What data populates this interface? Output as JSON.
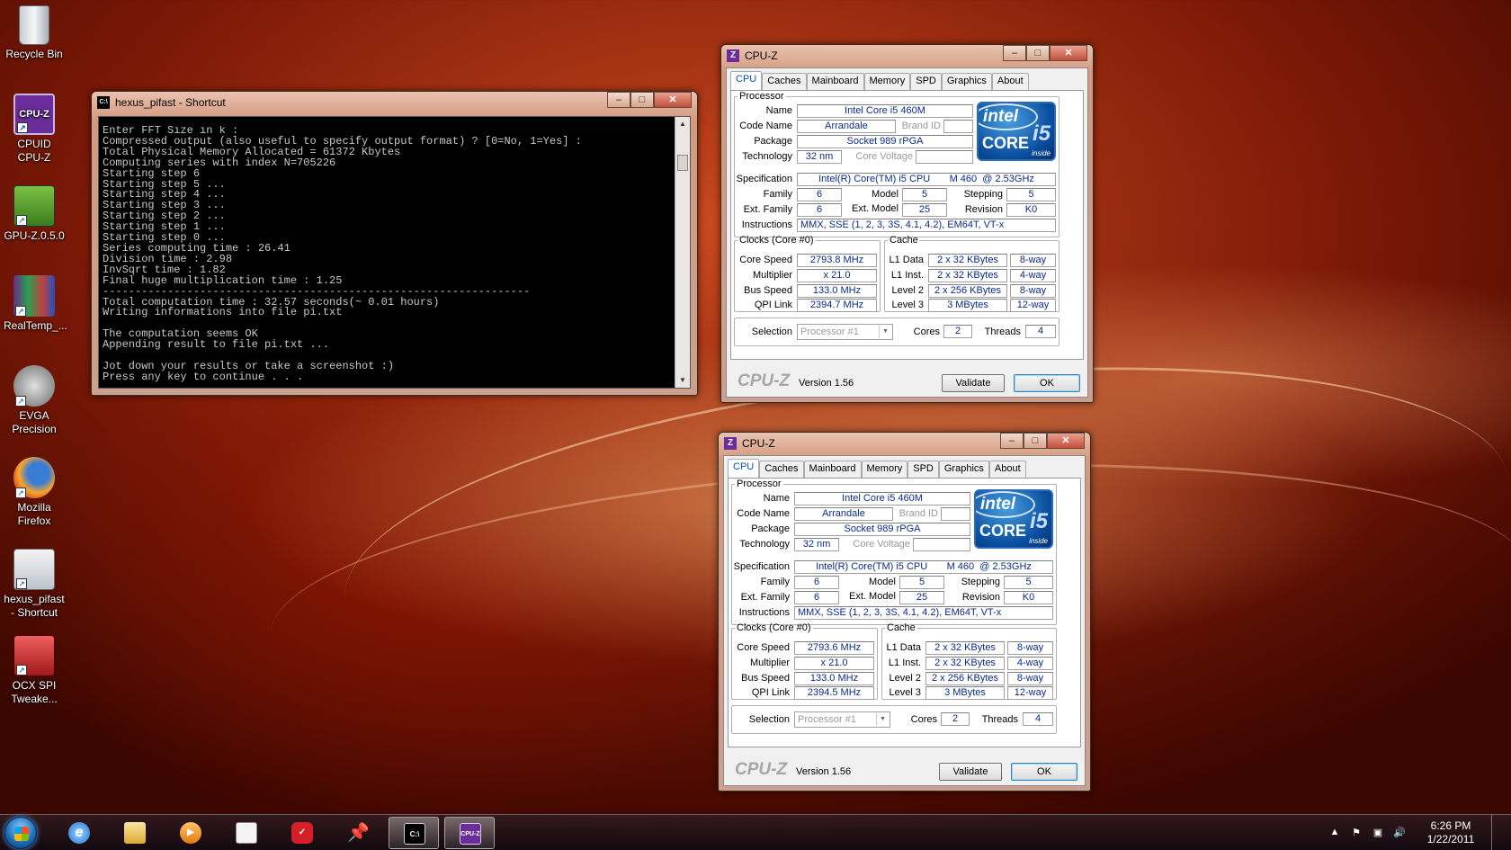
{
  "desktop": {
    "icons": [
      {
        "label": "Recycle Bin",
        "icon": "recycle-bin-icon"
      },
      {
        "label": "CPUID CPU-Z",
        "icon": "cpu-z-icon"
      },
      {
        "label": "GPU-Z.0.5.0",
        "icon": "gpu-z-icon"
      },
      {
        "label": "RealTemp_...",
        "icon": "realtemp-icon"
      },
      {
        "label": "EVGA Precision",
        "icon": "evga-precision-icon"
      },
      {
        "label": "Mozilla Firefox",
        "icon": "firefox-icon"
      },
      {
        "label": "hexus_pifast - Shortcut",
        "icon": "pifast-icon"
      },
      {
        "label": "OCX SPI Tweake...",
        "icon": "ocx-spi-icon"
      }
    ]
  },
  "console": {
    "title": "hexus_pifast - Shortcut",
    "icon_text": "C:\\",
    "output": "Enter FFT Size in k :\nCompressed output (also useful to specify output format) ? [0=No, 1=Yes] :\nTotal Physical Memory Allocated = 61372 Kbytes\nComputing series with index N=705226\nStarting step 6\nStarting step 5 ...\nStarting step 4 ...\nStarting step 3 ...\nStarting step 2 ...\nStarting step 1 ...\nStarting step 0 ...\nSeries computing time : 26.41\nDivision time : 2.98\nInvSqrt time : 1.82\nFinal huge multiplication time : 1.25\n------------------------------------------------------------------\nTotal computation time : 32.57 seconds(~ 0.01 hours)\nWriting informations into file pi.txt\n\nThe computation seems OK\nAppending result to file pi.txt ...\n\nJot down your results or take a screenshot :)\nPress any key to continue . . ."
  },
  "cpuz_windows": [
    {
      "title": "CPU-Z",
      "tabs": [
        "CPU",
        "Caches",
        "Mainboard",
        "Memory",
        "SPD",
        "Graphics",
        "About"
      ],
      "processor": {
        "group": "Processor",
        "name_label": "Name",
        "name": "Intel Core i5 460M",
        "codename_label": "Code Name",
        "codename": "Arrandale",
        "brandid_label": "Brand ID",
        "package_label": "Package",
        "package": "Socket 989 rPGA",
        "technology_label": "Technology",
        "technology": "32 nm",
        "voltage_label": "Core Voltage",
        "spec_label": "Specification",
        "spec": "Intel(R) Core(TM) i5 CPU       M 460  @ 2.53GHz",
        "family_label": "Family",
        "family": "6",
        "model_label": "Model",
        "model": "5",
        "stepping_label": "Stepping",
        "stepping": "5",
        "extfamily_label": "Ext. Family",
        "extfamily": "6",
        "extmodel_label": "Ext. Model",
        "extmodel": "25",
        "revision_label": "Revision",
        "revision": "K0",
        "instructions_label": "Instructions",
        "instructions": "MMX, SSE (1, 2, 3, 3S, 4.1, 4.2), EM64T, VT-x"
      },
      "logo": {
        "intel": "intel",
        "core": "CORE",
        "i5": "i5",
        "inside": "inside"
      },
      "clocks": {
        "group": "Clocks (Core #0)",
        "corespeed_label": "Core Speed",
        "corespeed": "2793.8 MHz",
        "multiplier_label": "Multiplier",
        "multiplier": "x 21.0",
        "busspeed_label": "Bus Speed",
        "busspeed": "133.0 MHz",
        "qpi_label": "QPI Link",
        "qpi": "2394.7 MHz"
      },
      "cache": {
        "group": "Cache",
        "l1d_label": "L1 Data",
        "l1d": "2 x 32 KBytes",
        "l1d_way": "8-way",
        "l1i_label": "L1 Inst.",
        "l1i": "2 x 32 KBytes",
        "l1i_way": "4-way",
        "l2_label": "Level 2",
        "l2": "2 x 256 KBytes",
        "l2_way": "8-way",
        "l3_label": "Level 3",
        "l3": "3 MBytes",
        "l3_way": "12-way"
      },
      "selection": {
        "label": "Selection",
        "value": "Processor #1",
        "cores_label": "Cores",
        "cores": "2",
        "threads_label": "Threads",
        "threads": "4"
      },
      "footer": {
        "brand": "CPU-Z",
        "version": "Version 1.56",
        "validate": "Validate",
        "ok": "OK"
      }
    },
    {
      "title": "CPU-Z",
      "tabs": [
        "CPU",
        "Caches",
        "Mainboard",
        "Memory",
        "SPD",
        "Graphics",
        "About"
      ],
      "processor": {
        "group": "Processor",
        "name_label": "Name",
        "name": "Intel Core i5 460M",
        "codename_label": "Code Name",
        "codename": "Arrandale",
        "brandid_label": "Brand ID",
        "package_label": "Package",
        "package": "Socket 989 rPGA",
        "technology_label": "Technology",
        "technology": "32 nm",
        "voltage_label": "Core Voltage",
        "spec_label": "Specification",
        "spec": "Intel(R) Core(TM) i5 CPU       M 460  @ 2.53GHz",
        "family_label": "Family",
        "family": "6",
        "model_label": "Model",
        "model": "5",
        "stepping_label": "Stepping",
        "stepping": "5",
        "extfamily_label": "Ext. Family",
        "extfamily": "6",
        "extmodel_label": "Ext. Model",
        "extmodel": "25",
        "revision_label": "Revision",
        "revision": "K0",
        "instructions_label": "Instructions",
        "instructions": "MMX, SSE (1, 2, 3, 3S, 4.1, 4.2), EM64T, VT-x"
      },
      "logo": {
        "intel": "intel",
        "core": "CORE",
        "i5": "i5",
        "inside": "inside"
      },
      "clocks": {
        "group": "Clocks (Core #0)",
        "corespeed_label": "Core Speed",
        "corespeed": "2793.6 MHz",
        "multiplier_label": "Multiplier",
        "multiplier": "x 21.0",
        "busspeed_label": "Bus Speed",
        "busspeed": "133.0 MHz",
        "qpi_label": "QPI Link",
        "qpi": "2394.5 MHz"
      },
      "cache": {
        "group": "Cache",
        "l1d_label": "L1 Data",
        "l1d": "2 x 32 KBytes",
        "l1d_way": "8-way",
        "l1i_label": "L1 Inst.",
        "l1i": "2 x 32 KBytes",
        "l1i_way": "4-way",
        "l2_label": "Level 2",
        "l2": "2 x 256 KBytes",
        "l2_way": "8-way",
        "l3_label": "Level 3",
        "l3": "3 MBytes",
        "l3_way": "12-way"
      },
      "selection": {
        "label": "Selection",
        "value": "Processor #1",
        "cores_label": "Cores",
        "cores": "2",
        "threads_label": "Threads",
        "threads": "4"
      },
      "footer": {
        "brand": "CPU-Z",
        "version": "Version 1.56",
        "validate": "Validate",
        "ok": "OK"
      }
    }
  ],
  "taskbar": {
    "items": [
      {
        "icon": "internet-explorer-icon"
      },
      {
        "icon": "windows-explorer-icon"
      },
      {
        "icon": "media-player-icon"
      },
      {
        "icon": "notepad-icon"
      },
      {
        "icon": "checklist-icon"
      },
      {
        "icon": "pushpin-icon"
      },
      {
        "icon": "command-prompt-icon",
        "glyph": "C:\\"
      },
      {
        "icon": "cpu-z-taskbar-icon",
        "glyph": "CPU-Z"
      }
    ],
    "clock_time": "6:26 PM",
    "clock_date": "1/22/2011"
  }
}
